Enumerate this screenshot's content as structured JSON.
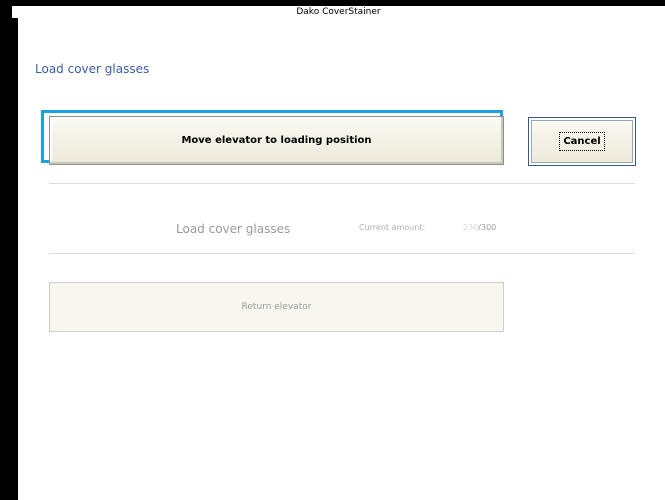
{
  "window": {
    "title": "Dako CoverStainer"
  },
  "page": {
    "title": "Load cover glasses"
  },
  "actions": {
    "move_elevator_label": "Move elevator to loading position",
    "cancel_label": "Cancel",
    "return_elevator_label": "Return elevator"
  },
  "load": {
    "label": "Load cover glasses",
    "current_amount_label": "Current amount:",
    "current_amount": "230",
    "max_amount": "/300"
  },
  "colors": {
    "focus_ring": "#1aa3dc",
    "title_text": "#3a5fa3"
  }
}
